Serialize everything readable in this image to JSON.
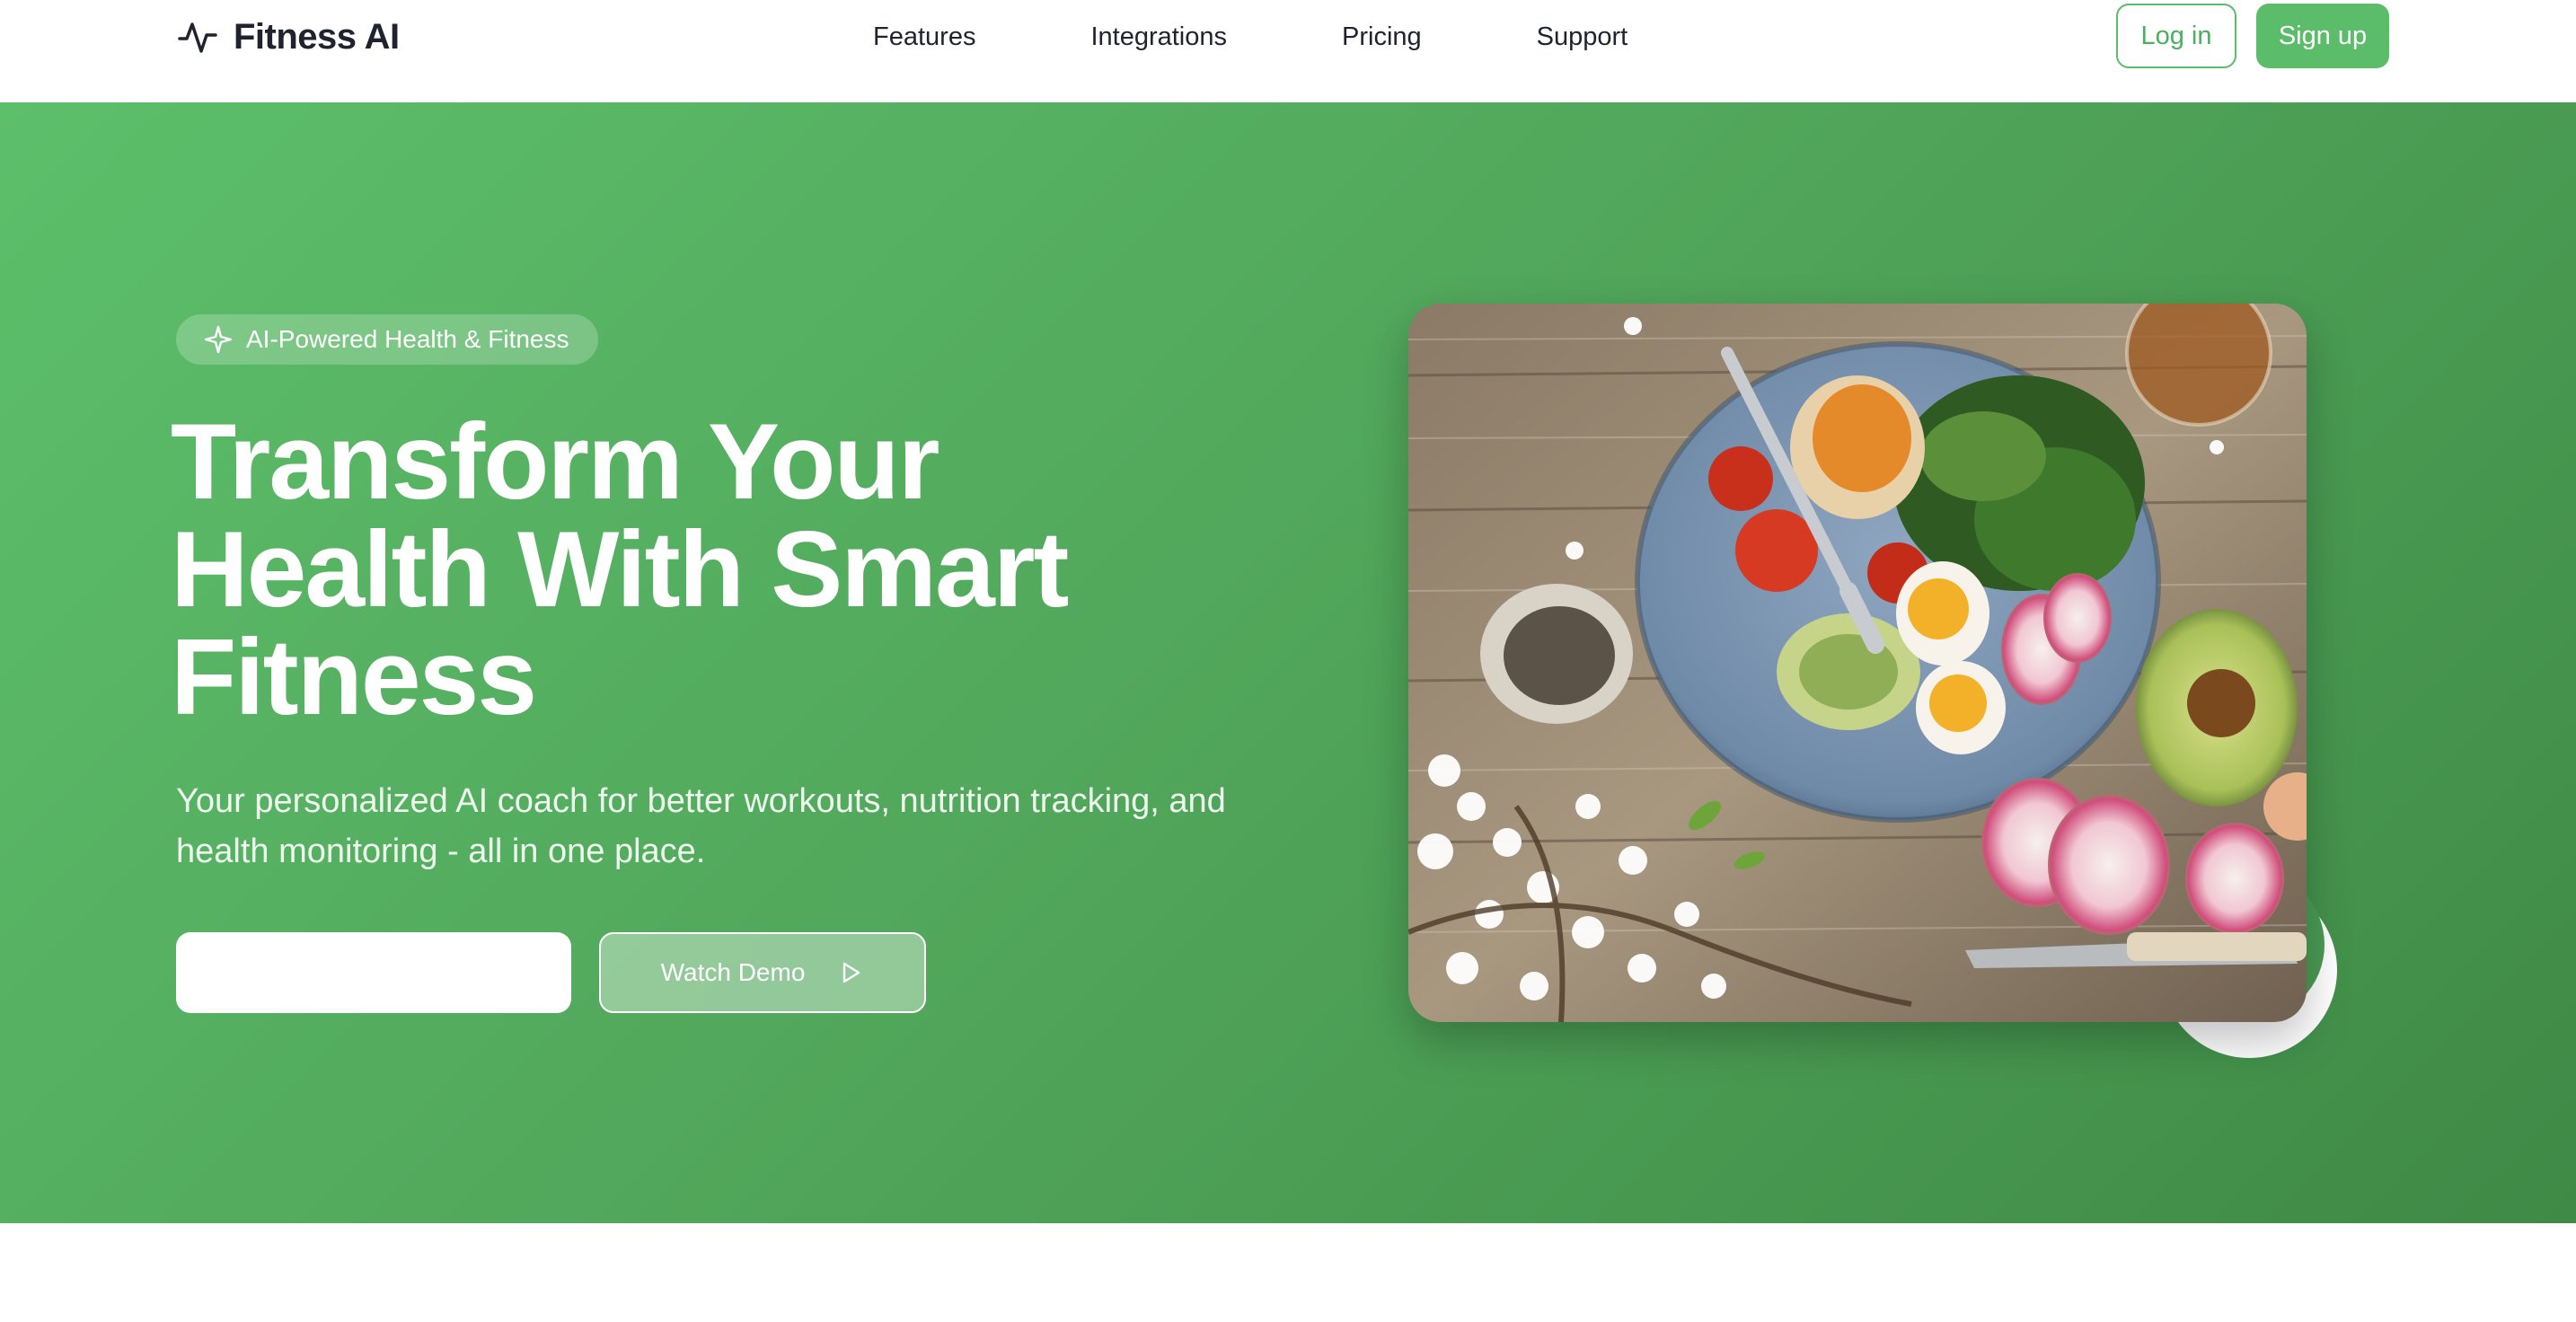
{
  "brand": {
    "name": "Fitness AI",
    "icon": "activity-pulse-icon"
  },
  "nav": {
    "links": [
      "Features",
      "Integrations",
      "Pricing",
      "Support"
    ],
    "login_label": "Log in",
    "signup_label": "Sign up"
  },
  "hero": {
    "badge": {
      "icon": "sparkle-icon",
      "label": "AI-Powered Health & Fitness"
    },
    "headline_lines": [
      "Transform Your",
      "Health With Smart",
      "Fitness"
    ],
    "subtitle": "Your personalized AI coach for better workouts, nutrition tracking, and health monitoring - all in one place.",
    "primary_button_label": "",
    "demo_button_label": "Watch Demo",
    "demo_button_icon": "play-icon",
    "image": "healthy-food-bowl-photo"
  },
  "colors": {
    "accent": "#5bbd6a",
    "hero_gradient_start": "#5cbf6a",
    "hero_gradient_end": "#3f8a46",
    "text_dark": "#1f2330"
  }
}
